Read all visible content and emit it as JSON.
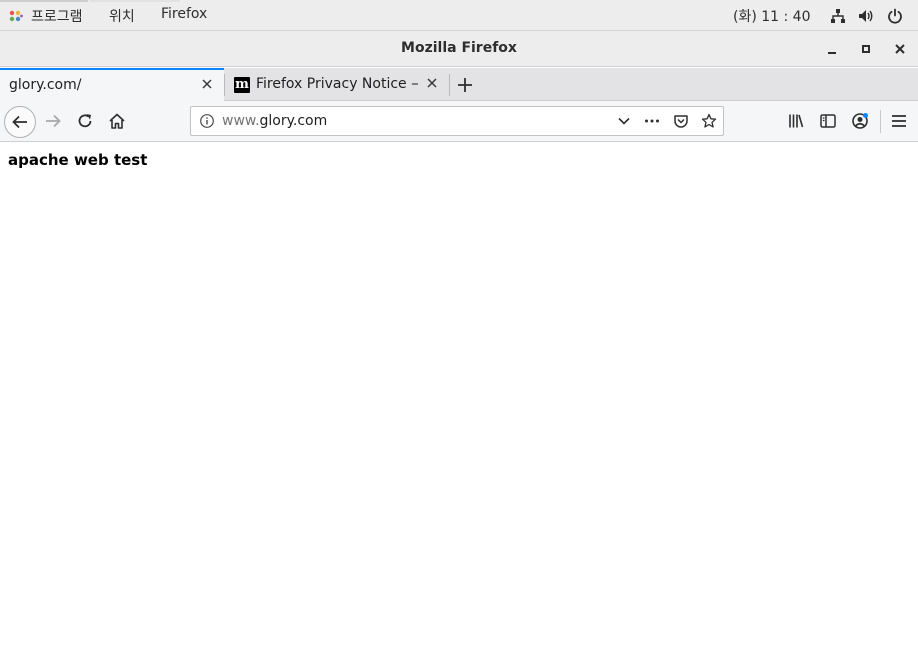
{
  "topbar": {
    "apps_label": "프로그램",
    "places_label": "위치",
    "app_name": "Firefox",
    "clock": "(화) 11 : 40"
  },
  "window": {
    "title": "Mozilla Firefox"
  },
  "tabs": [
    {
      "label": "glory.com/",
      "active": true
    },
    {
      "label": "Firefox Privacy Notice —",
      "active": false,
      "favicon": "m"
    }
  ],
  "navbar": {
    "url_prefix": "www.",
    "url_domain": "glory.com"
  },
  "page": {
    "heading": "apache web test"
  },
  "colors": {
    "accent": "#0a84ff",
    "chrome_bg": "#ededed",
    "toolbar_bg": "#f5f6f7"
  }
}
